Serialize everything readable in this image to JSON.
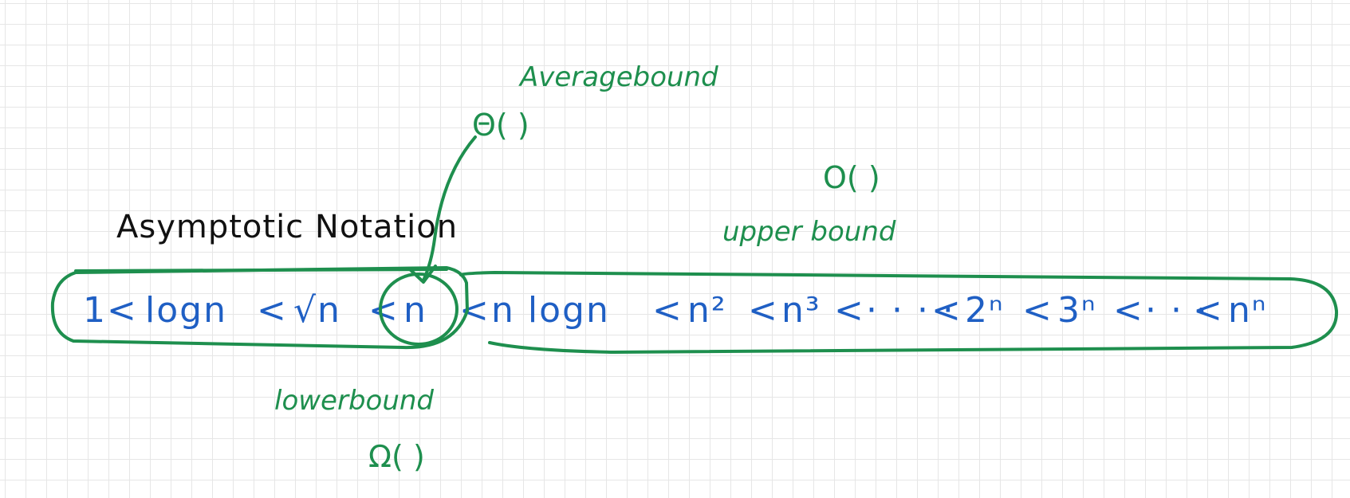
{
  "title": "Asymptotic Notation",
  "series": [
    "1",
    "<",
    "logn",
    "<",
    "√n",
    "<",
    "n",
    "<",
    "n logn",
    "<",
    "n²",
    "<",
    "n³",
    "<",
    "· · · ·",
    "<",
    "2ⁿ",
    "<",
    "3ⁿ",
    "<",
    "· · ·",
    "<",
    "nⁿ"
  ],
  "bounds": {
    "average": {
      "label": "Averagebound",
      "symbol": "Θ( )"
    },
    "upper": {
      "label": "upper bound",
      "symbol": "O( )"
    },
    "lower": {
      "label": "lowerbound",
      "symbol": "Ω( )"
    }
  },
  "colors": {
    "series": "#1f5fc4",
    "annotation": "#1e8f4e",
    "title": "#111111",
    "grid": "#e6e6e6"
  }
}
